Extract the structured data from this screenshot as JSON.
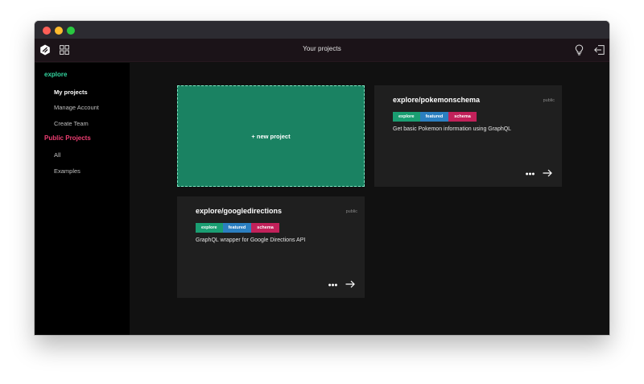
{
  "window": {
    "traffic_lights": [
      "close",
      "minimize",
      "zoom"
    ]
  },
  "header": {
    "title": "Your projects",
    "icons": [
      "app-logo-icon",
      "grid-icon",
      "lightbulb-icon",
      "logout-icon"
    ]
  },
  "sidebar": {
    "explore_heading": "explore",
    "explore_items": [
      {
        "label": "My projects",
        "active": true
      },
      {
        "label": "Manage Account",
        "active": false
      },
      {
        "label": "Create Team",
        "active": false
      }
    ],
    "public_heading": "Public Projects",
    "public_items": [
      {
        "label": "All"
      },
      {
        "label": "Examples"
      }
    ]
  },
  "new_project": {
    "label": "+ new project"
  },
  "projects": [
    {
      "title": "explore/pokemonschema",
      "visibility": "public",
      "tags": [
        "explore",
        "featured",
        "schema"
      ],
      "description": "Get basic Pokemon information using GraphQL"
    },
    {
      "title": "explore/googledirections",
      "visibility": "public",
      "tags": [
        "explore",
        "featured",
        "schema"
      ],
      "description": "GraphQL wrapper for Google Directions API"
    }
  ],
  "colors": {
    "accent_green": "#33d6a0",
    "accent_pink": "#f03e73",
    "new_card": "#1a8262",
    "tag_explore": "#1a9e72",
    "tag_featured": "#2b7fc0",
    "tag_schema": "#c2215a"
  }
}
